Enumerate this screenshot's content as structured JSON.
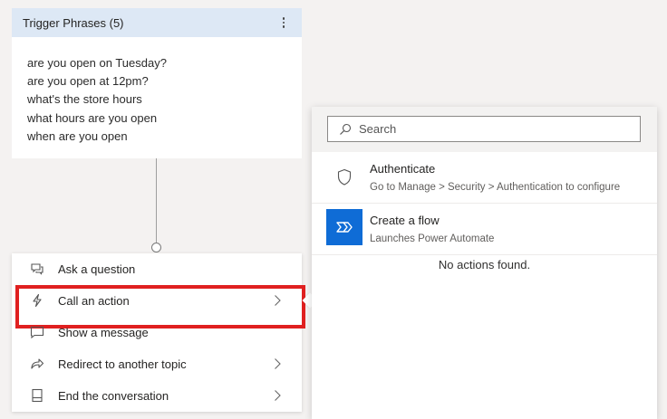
{
  "trigger": {
    "header": "Trigger Phrases (5)",
    "phrases": [
      "are you open on Tuesday?",
      "are you open at 12pm?",
      "what's the store hours",
      "what hours are you open",
      "when are you open"
    ]
  },
  "menu": {
    "items": [
      {
        "label": "Ask a question",
        "icon": "chat-question-icon",
        "chevron": false
      },
      {
        "label": "Call an action",
        "icon": "lightning-icon",
        "chevron": true,
        "highlighted": true
      },
      {
        "label": "Show a message",
        "icon": "message-icon",
        "chevron": false
      },
      {
        "label": "Redirect to another topic",
        "icon": "redirect-arrow-icon",
        "chevron": true
      },
      {
        "label": "End the conversation",
        "icon": "end-conversation-icon",
        "chevron": true
      }
    ]
  },
  "panel": {
    "search_placeholder": "Search",
    "actions": [
      {
        "title": "Authenticate",
        "subtitle": "Go to Manage > Security > Authentication to configure",
        "icon": "shield-icon"
      },
      {
        "title": "Create a flow",
        "subtitle": "Launches Power Automate",
        "icon": "power-automate-icon"
      }
    ],
    "empty_text": "No actions found."
  },
  "colors": {
    "highlight_border": "#e02020",
    "trigger_header_bg": "#dde8f5",
    "flow_tile": "#0f6cd6"
  }
}
